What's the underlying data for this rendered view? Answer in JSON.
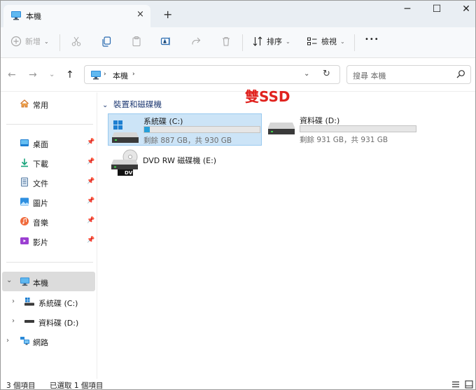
{
  "window": {
    "tab_title": "本機",
    "tab_close": "×",
    "new_tab": "+",
    "minimize": "─",
    "maximize": "☐",
    "close": "✕"
  },
  "toolbar": {
    "new_label": "新增",
    "sort_label": "排序",
    "view_label": "檢視",
    "more_label": "•••"
  },
  "address": {
    "crumb_root": "本機",
    "search_placeholder": "搜尋 本機"
  },
  "nav": {
    "quick_access": "常用",
    "pinned": [
      {
        "label": "桌面",
        "icon": "desktop-folder-icon"
      },
      {
        "label": "下載",
        "icon": "download-folder-icon"
      },
      {
        "label": "文件",
        "icon": "documents-folder-icon"
      },
      {
        "label": "圖片",
        "icon": "pictures-folder-icon"
      },
      {
        "label": "音樂",
        "icon": "music-folder-icon"
      },
      {
        "label": "影片",
        "icon": "videos-folder-icon"
      }
    ],
    "this_pc": "本機",
    "drives": [
      "系統碟 (C:)",
      "資料碟 (D:)"
    ],
    "network": "網路"
  },
  "content": {
    "group_header": "裝置和磁碟機",
    "annotation": "雙SSD",
    "drives": [
      {
        "name": "系統碟 (C:)",
        "free": "剩餘 887 GB，共 930 GB",
        "used_fraction": 0.046
      },
      {
        "name": "資料碟 (D:)",
        "free": "剩餘 931 GB，共 931 GB",
        "used_fraction": 0.0
      },
      {
        "name": "DVD RW 磁碟機 (E:)",
        "badge": "DVD"
      }
    ]
  },
  "status": {
    "item_count": "3 個項目",
    "selected": "已選取 1 個項目"
  },
  "colors": {
    "accent": "#26a0da",
    "selection": "#cce4f7",
    "annotation": "#e0231f"
  }
}
